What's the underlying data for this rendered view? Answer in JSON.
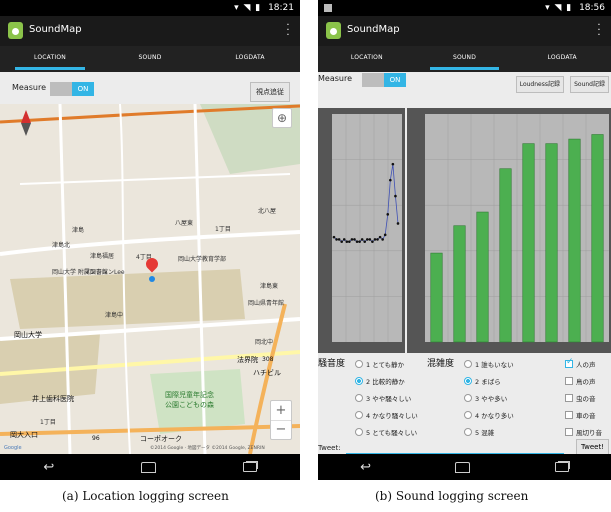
{
  "location_screen": {
    "status_time": "18:21",
    "app_title": "SoundMap",
    "tabs": [
      "LOCATION",
      "SOUND",
      "LOGDATA"
    ],
    "active_tab": "LOCATION",
    "measure_label": "Measure",
    "measure_toggle": "ON",
    "follow_button": "視点追従",
    "map_labels": {
      "kita_hachiya": "北八屋",
      "area_hachiya": "八屋東",
      "itchome_a": "1丁目",
      "tsushima": "津島",
      "tsushima_kita": "津島北",
      "tsushima_fukui": "津島福居",
      "mansion": "マンションLee",
      "yonchome": "4丁目",
      "okadai_kyoiku": "岡山大学教育学部",
      "okadai_fuzoku": "岡山大学\n附属図書館",
      "tsushima_minami": "津島東",
      "okayama_kyoiku": "岡山県青年館",
      "tsushima_naka": "津島中",
      "okayama_univ": "岡山大学",
      "kitanaka": "岡北中",
      "hoshojuin": "法界院",
      "hachibiru": "ハチビル",
      "route_number": "308",
      "inoue_dental": "井上歯科医院",
      "park_line1": "国際児童年記念",
      "park_line2": "公園こどもの森",
      "itchome_b": "1丁目",
      "okadai_iriguchi": "岡大入口",
      "road_96": "96",
      "copo_oak": "コーポオーク",
      "attribution": "©2014 Google · 地図データ ©2014 Google, ZENRIN",
      "google_logo": "Google"
    },
    "zoom_in": "+",
    "zoom_out": "−"
  },
  "sound_screen": {
    "status_time": "18:56",
    "app_title": "SoundMap",
    "tabs": [
      "LOCATION",
      "SOUND",
      "LOGDATA"
    ],
    "active_tab": "SOUND",
    "measure_label": "Measure",
    "measure_toggle": "ON",
    "loudness_button": "Loudness記録",
    "sound_button": "Sound記録",
    "questions": {
      "noise": {
        "label": "騒音度",
        "options": [
          "1 とても静か",
          "2 比較的静か",
          "3 やや騒々しい",
          "4 かなり騒々しい",
          "5 とても騒々しい"
        ],
        "selected_index": 1
      },
      "crowd": {
        "label": "混雑度",
        "options": [
          "1 誰もいない",
          "2 まばら",
          "3 やや多い",
          "4 かなり多い",
          "5 混雑"
        ],
        "selected_index": 1
      },
      "sources": {
        "options": [
          "人の声",
          "鳥の声",
          "虫の音",
          "車の音",
          "風切り音"
        ],
        "checked": [
          true,
          false,
          false,
          false,
          false
        ]
      }
    },
    "tweet_label": "Tweet:",
    "tweet_value": "",
    "tweet_button": "Tweet!"
  },
  "captions": {
    "a": "(a) Location logging screen",
    "b": "(b) Sound logging screen"
  },
  "chart_data": [
    {
      "type": "line",
      "x": [
        1,
        2,
        3,
        4,
        5,
        6,
        7,
        8,
        9,
        10,
        11,
        12,
        13,
        14,
        15,
        16,
        17,
        18,
        19,
        20,
        21,
        22,
        23,
        24,
        25,
        26
      ],
      "values": [
        0.46,
        0.45,
        0.45,
        0.44,
        0.45,
        0.44,
        0.44,
        0.45,
        0.45,
        0.44,
        0.44,
        0.45,
        0.44,
        0.45,
        0.45,
        0.44,
        0.45,
        0.45,
        0.46,
        0.45,
        0.47,
        0.56,
        0.71,
        0.78,
        0.64,
        0.52
      ],
      "ylim": [
        0,
        1
      ],
      "grid": true
    },
    {
      "type": "bar",
      "categories": [
        "1",
        "2",
        "3",
        "4",
        "5",
        "6",
        "7",
        "8"
      ],
      "values": [
        0.39,
        0.51,
        0.57,
        0.76,
        0.87,
        0.87,
        0.89,
        0.91
      ],
      "ylim": [
        0,
        1
      ],
      "grid": true,
      "bar_color": "#4caf50"
    }
  ],
  "colors": {
    "accent": "#33b5e5",
    "bar_green": "#4caf50",
    "pin_red": "#e53935"
  }
}
